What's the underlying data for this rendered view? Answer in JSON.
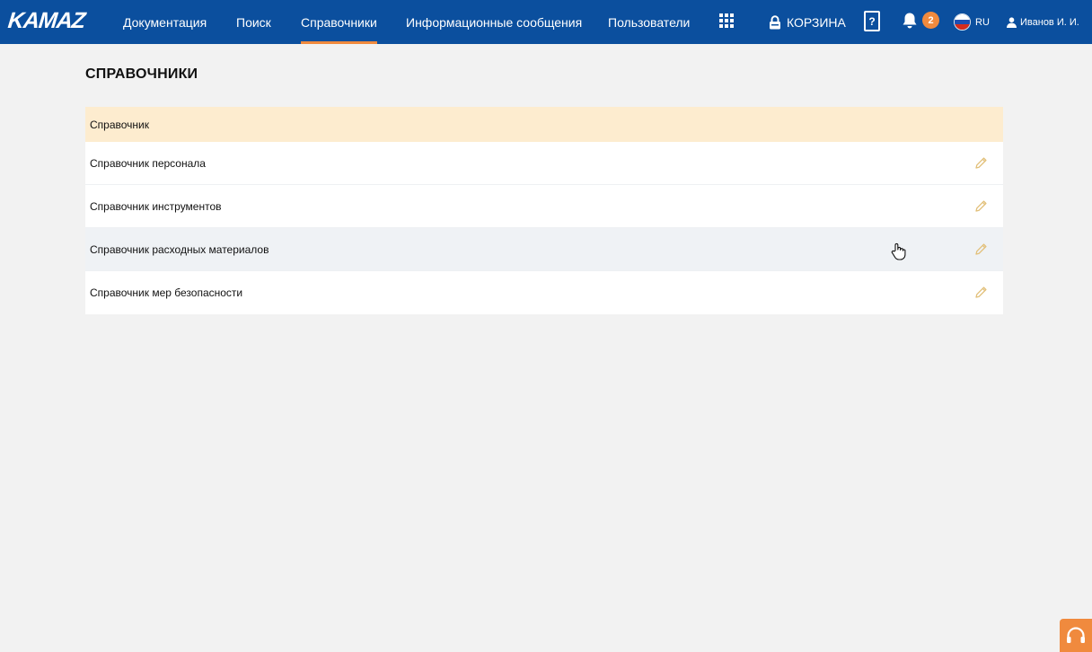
{
  "header": {
    "logo": "KAMAZ",
    "nav": [
      {
        "label": "Документация"
      },
      {
        "label": "Поиск"
      },
      {
        "label": "Справочники",
        "active": true
      },
      {
        "label": "Информационные сообщения"
      },
      {
        "label": "Пользователи"
      }
    ],
    "cart_label": "КОРЗИНА",
    "help_label": "?",
    "notifications_count": "2",
    "language": "RU",
    "user_name": "Иванов И. И."
  },
  "page": {
    "title": "СПРАВОЧНИКИ",
    "table": {
      "header": "Справочник",
      "rows": [
        {
          "label": "Справочник персонала"
        },
        {
          "label": "Справочник инструментов"
        },
        {
          "label": "Справочник расходных материалов",
          "hovered": true
        },
        {
          "label": "Справочник мер безопасности"
        }
      ]
    }
  },
  "icons": {
    "apps": "grid-icon",
    "cart": "lock-icon",
    "help": "help-book-icon",
    "bell": "bell-icon",
    "flag": "russia-flag-icon",
    "user": "user-icon",
    "edit": "pencil-icon",
    "support": "headset-icon"
  },
  "colors": {
    "header_bg": "#0b4f9e",
    "accent": "#f08a3e",
    "table_header_bg": "#fdeccf",
    "row_hover_bg": "#eff2f5",
    "edit_icon": "#e2c07a"
  }
}
